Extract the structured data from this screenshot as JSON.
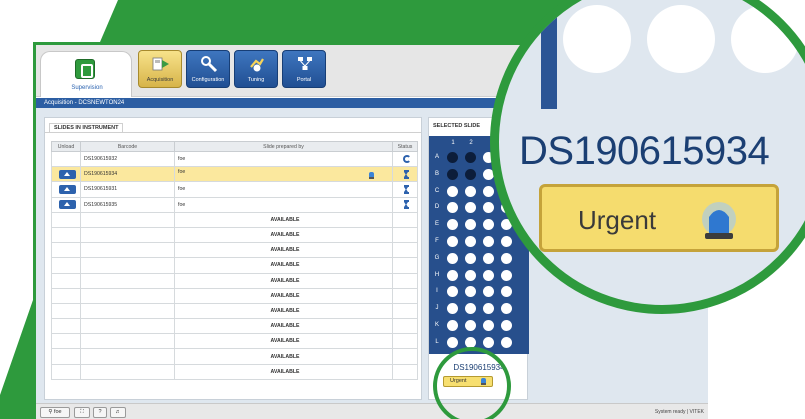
{
  "colors": {
    "frame_green": "#2e9a3d",
    "brand_blue": "#2c5ea3",
    "selected_row": "#fbe89e",
    "urgent_yellow": "#f7df70"
  },
  "toolbar": {
    "supervision_label": "Supervision",
    "buttons": [
      {
        "label": "Acquisition",
        "icon": "slides-arrow-icon",
        "active": true
      },
      {
        "label": "Configuration",
        "icon": "wrench-icon",
        "active": false
      },
      {
        "label": "Tuning",
        "icon": "tuning-hand-icon",
        "active": false
      },
      {
        "label": "Portal",
        "icon": "network-icon",
        "active": false
      }
    ]
  },
  "breadcrumb": "Acquisition - DCSNEWTON24",
  "slides_panel": {
    "title": "SLIDES IN INSTRUMENT",
    "columns": [
      "Unload",
      "Barcode",
      "Slide prepared by",
      "Status"
    ],
    "rows": [
      {
        "barcode": "DS190615932",
        "prepared_by": "foe",
        "status": "refresh"
      },
      {
        "barcode": "DS190615934",
        "prepared_by": "foe",
        "status": "hourglass",
        "selected": true
      },
      {
        "barcode": "DS190615931",
        "prepared_by": "foe",
        "status": "hourglass"
      },
      {
        "barcode": "DS190615935",
        "prepared_by": "foe",
        "status": "hourglass"
      }
    ],
    "available_label": "AVAILABLE",
    "available_count": 11
  },
  "selected_panel": {
    "title": "SELECTED SLIDE",
    "columns": [
      "1",
      "2"
    ],
    "rows": [
      "A",
      "B",
      "C",
      "D",
      "E",
      "F",
      "G",
      "H",
      "I",
      "J",
      "K",
      "L"
    ],
    "filled_cells": [
      [
        0,
        0
      ],
      [
        0,
        1
      ],
      [
        1,
        0
      ],
      [
        1,
        1
      ]
    ],
    "barcode": "DS190615934",
    "urgent_label": "Urgent"
  },
  "statusbar": {
    "user_label": "foe",
    "status_text": "System ready | VITEK"
  },
  "magnifier": {
    "barcode": "DS190615934",
    "urgent_label": "Urgent"
  }
}
